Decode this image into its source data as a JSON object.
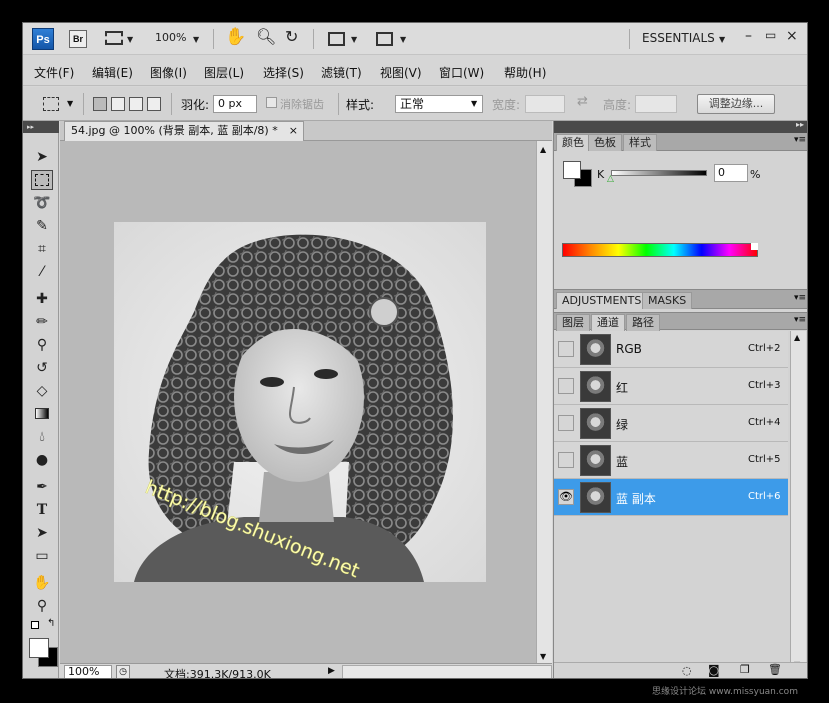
{
  "app": {
    "logo": "Ps",
    "bridge": "Br",
    "zoom": "100%",
    "workspace": "ESSENTIALS"
  },
  "menu": [
    "文件(F)",
    "编辑(E)",
    "图像(I)",
    "图层(L)",
    "选择(S)",
    "滤镜(T)",
    "视图(V)",
    "窗口(W)",
    "帮助(H)"
  ],
  "options": {
    "feather_label": "羽化:",
    "feather_value": "0 px",
    "antialias_label": "消除锯齿",
    "style_label": "样式:",
    "style_value": "正常",
    "width_label": "宽度:",
    "height_label": "高度:",
    "refine_button": "调整边缘..."
  },
  "document": {
    "tab_title": "54.jpg @ 100% (背景 副本, 蓝 副本/8) *",
    "watermark": "http://blog.shuxiong.net",
    "zoom": "100%",
    "doc_info": "文档:391.3K/913.0K"
  },
  "color_panel": {
    "tabs": [
      "颜色",
      "色板",
      "样式"
    ],
    "channel": "K",
    "value": "0",
    "unit": "%"
  },
  "adjust_panel": {
    "tabs": [
      "ADJUSTMENTS",
      "MASKS"
    ]
  },
  "channels_panel": {
    "tabs": [
      "图层",
      "通道",
      "路径"
    ],
    "rows": [
      {
        "name": "RGB",
        "shortcut": "Ctrl+2"
      },
      {
        "name": "红",
        "shortcut": "Ctrl+3"
      },
      {
        "name": "绿",
        "shortcut": "Ctrl+4"
      },
      {
        "name": "蓝",
        "shortcut": "Ctrl+5"
      },
      {
        "name": "蓝 副本",
        "shortcut": "Ctrl+6"
      }
    ]
  },
  "footer_watermark": "思缘设计论坛  www.missyuan.com",
  "colors": {
    "selection": "#3d9be9",
    "panel": "#d3d3d3",
    "canvas_bg": "#b9b9b9"
  }
}
